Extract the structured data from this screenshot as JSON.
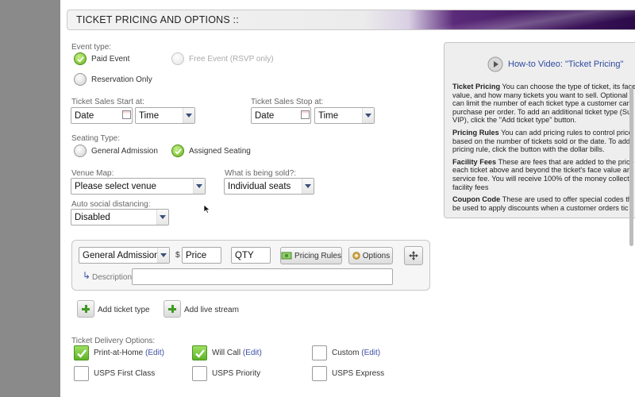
{
  "header": {
    "title": "TICKET PRICING AND OPTIONS ::"
  },
  "event_type": {
    "label": "Event type:",
    "paid": "Paid Event",
    "free": "Free Event (RSVP only)",
    "reservation": "Reservation Only"
  },
  "sales_start": {
    "label": "Ticket Sales Start at:",
    "date": "Date",
    "time": "Time"
  },
  "sales_stop": {
    "label": "Ticket Sales Stop at:",
    "date": "Date",
    "time": "Time"
  },
  "seating": {
    "label": "Seating Type:",
    "general": "General Admission",
    "assigned": "Assigned Seating"
  },
  "venue": {
    "label": "Venue Map:",
    "value": "Please select venue"
  },
  "sold": {
    "label": "What is being sold?:",
    "value": "Individual seats"
  },
  "distancing": {
    "label": "Auto social distancing:",
    "value": "Disabled"
  },
  "ticket": {
    "type": "General Admission",
    "currency": "$",
    "price_placeholder": "Price",
    "qty_placeholder": "QTY",
    "pricing_rules": "Pricing Rules",
    "options": "Options",
    "description_label": "Description"
  },
  "actions": {
    "add_ticket": "Add ticket type",
    "add_stream": "Add live stream"
  },
  "delivery": {
    "label": "Ticket Delivery Options:",
    "edit": "(Edit)",
    "print": "Print-at-Home",
    "willcall": "Will Call",
    "custom": "Custom",
    "usps_first": "USPS First Class",
    "usps_priority": "USPS Priority",
    "usps_express": "USPS Express"
  },
  "help": {
    "video_title": "How-to Video: \"Ticket Pricing\"",
    "tp_title": "Ticket Pricing",
    "tp_l1": " You can choose the type of ticket, its face",
    "tp_l2": "value, and how many tickets you want to sell. Optional",
    "tp_l3": "can limit the number of each ticket type a customer can",
    "tp_l4": "purchase per order. To add an additional ticket type (Su",
    "tp_l5": "VIP), click the \"Add ticket type\" button.",
    "pr_title": "Pricing Rules",
    "pr_l1": " You can add pricing rules to control price",
    "pr_l2": "based on the number of tickets sold or the date. To add",
    "pr_l3": "pricing rule, click the button with the dollar bills.",
    "ff_title": "Facility Fees",
    "ff_l1": " These are fees that are added to the price",
    "ff_l2": "each ticket above and beyond the ticket's face value an",
    "ff_l3": "service fee. You will receive 100% of the money collect",
    "ff_l4": "facility fees",
    "cc_title": "Coupon Code",
    "cc_l1": " These are used to offer special codes th",
    "cc_l2": "be used to apply discounts when a customer orders tic"
  },
  "colors": {
    "accent_purple": "#4a1a6a",
    "check_green": "#5fb326",
    "link_blue": "#3d4fa3"
  }
}
